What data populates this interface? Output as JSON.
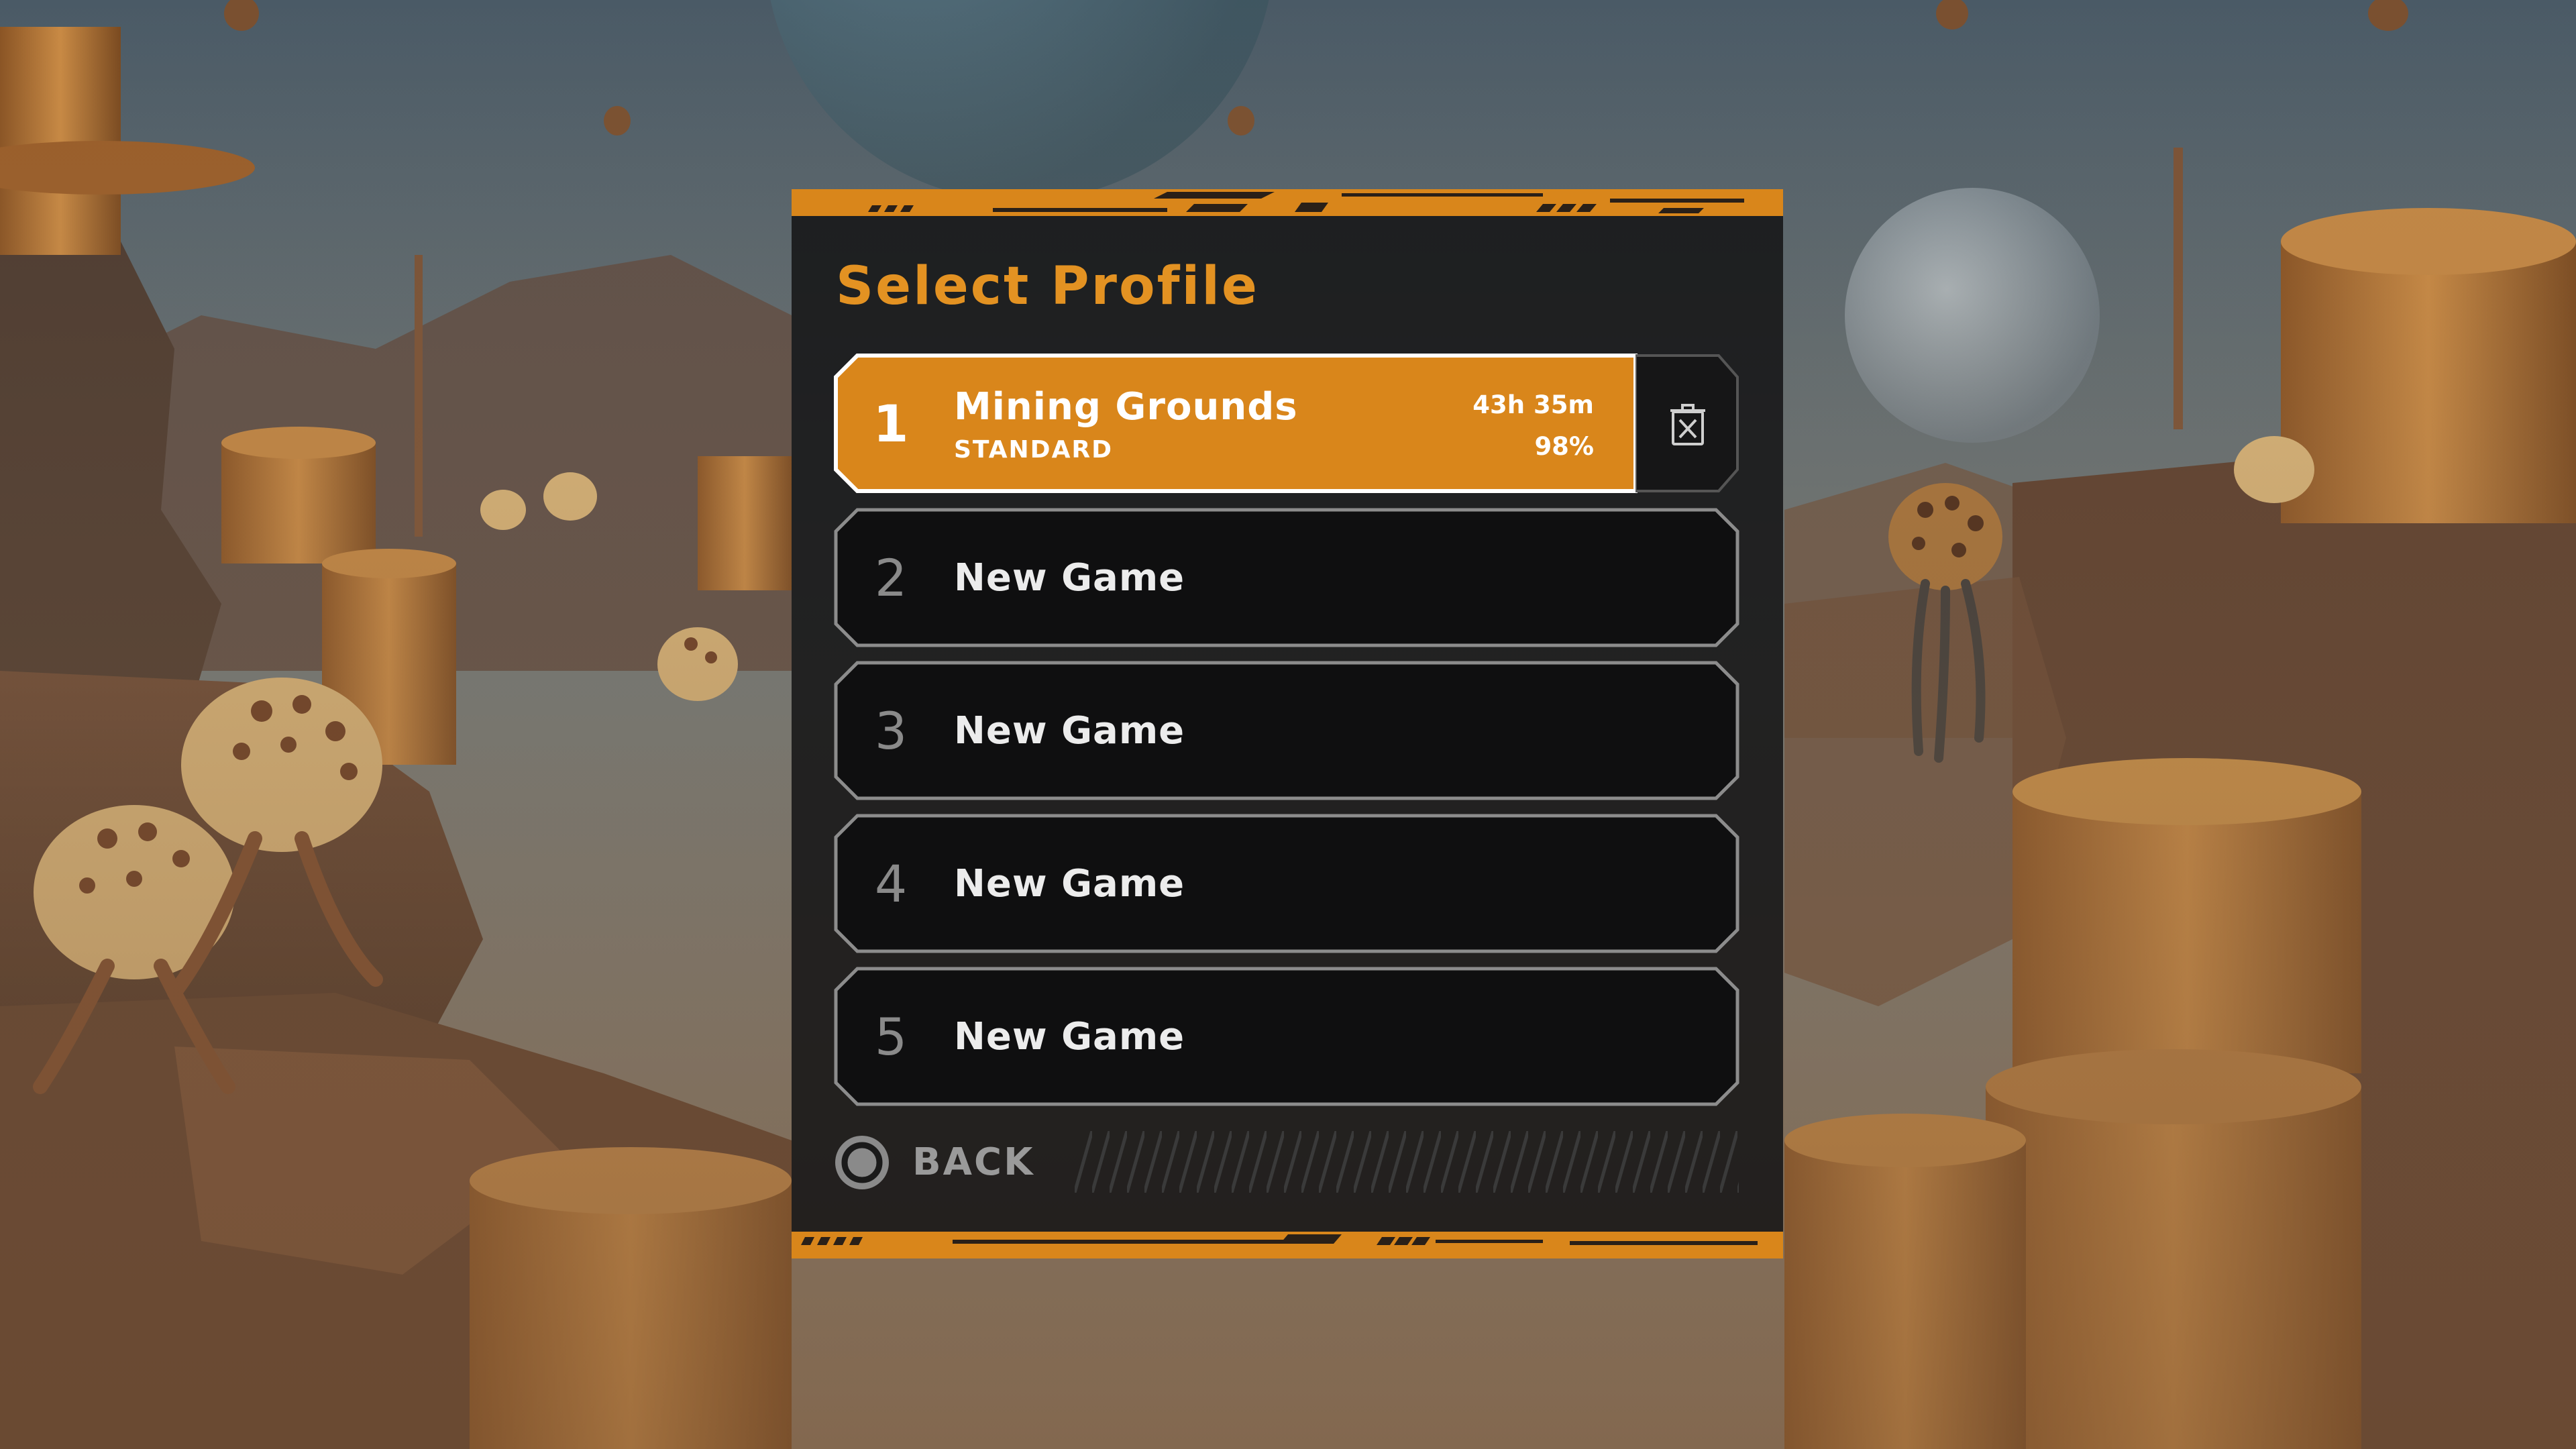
{
  "dialog": {
    "title": "Select Profile",
    "profiles": [
      {
        "number": "1",
        "name": "Mining Grounds",
        "mode": "STANDARD",
        "playtime": "43h 35m",
        "progress": "98%",
        "progress_value": 0.98,
        "selected": true
      },
      {
        "number": "2",
        "name": "New Game"
      },
      {
        "number": "3",
        "name": "New Game"
      },
      {
        "number": "4",
        "name": "New Game"
      },
      {
        "number": "5",
        "name": "New Game"
      }
    ],
    "delete_icon": "trash-icon",
    "back_icon": "circle-button-icon",
    "back_label": "BACK"
  },
  "colors": {
    "accent": "#d9861b",
    "title": "#e39222",
    "panel_bg": "#141415",
    "slot_border": "#8c8c8c",
    "text": "#ececec",
    "muted": "#8a8a8a"
  }
}
